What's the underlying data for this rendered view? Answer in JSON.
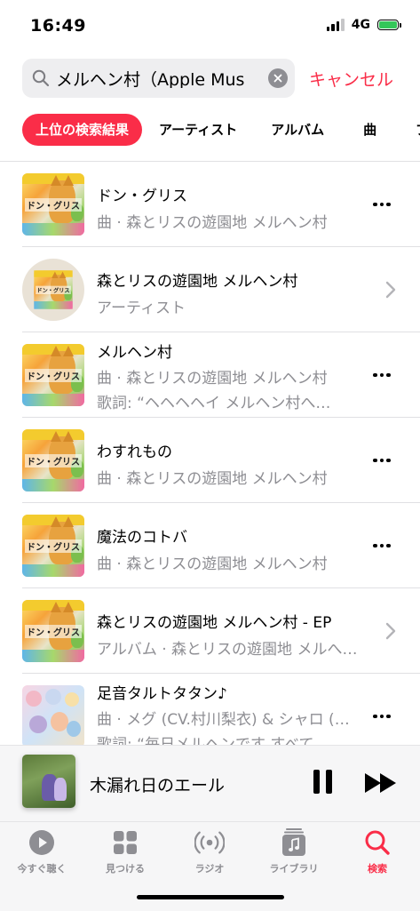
{
  "status": {
    "time": "16:49",
    "network": "4G"
  },
  "search": {
    "value": "メルヘン村（Apple Mus",
    "cancel_label": "キャンセル"
  },
  "tabs": [
    {
      "label": "上位の検索結果",
      "active": true
    },
    {
      "label": "アーティスト"
    },
    {
      "label": "アルバム"
    },
    {
      "label": "曲"
    },
    {
      "label": "プ"
    }
  ],
  "results": [
    {
      "title": "ドン・グリス",
      "subtitle": "曲 · 森とリスの遊園地 メルヘン村",
      "art_text": "ドン・グリス",
      "action": "more-icon"
    },
    {
      "title": "森とリスの遊園地 メルヘン村",
      "subtitle": "アーティスト",
      "art_text": "ドン・グリス",
      "action": "chevron-right-icon"
    },
    {
      "title": "メルヘン村",
      "subtitle": "曲 · 森とリスの遊園地 メルヘン村",
      "lyrics": "歌詞: “ヘヘヘヘイ メルヘン村へ…",
      "art_text": "ドン・グリス",
      "action": "more-icon"
    },
    {
      "title": "わすれもの",
      "subtitle": "曲 · 森とリスの遊園地 メルヘン村",
      "art_text": "ドン・グリス",
      "action": "more-icon"
    },
    {
      "title": "魔法のコトバ",
      "subtitle": "曲 · 森とリスの遊園地 メルヘン村",
      "art_text": "ドン・グリス",
      "action": "more-icon"
    },
    {
      "title": "森とリスの遊園地 メルヘン村 - EP",
      "subtitle": "アルバム · 森とリスの遊園地 メルへ…",
      "art_text": "ドン・グリス",
      "action": "chevron-right-icon"
    },
    {
      "title": "足音タルトタタン♪",
      "subtitle": "曲 · メグ (CV.村川梨衣) & シャロ (…",
      "lyrics": "歌詞: “毎日メルヘンです すべて…",
      "action": "more-icon"
    }
  ],
  "now_playing": {
    "title": "木漏れ日のエール"
  },
  "tabbar": [
    {
      "label": "今すぐ聴く",
      "icon": "play-circle-icon"
    },
    {
      "label": "見つける",
      "icon": "grid-icon"
    },
    {
      "label": "ラジオ",
      "icon": "radio-icon"
    },
    {
      "label": "ライブラリ",
      "icon": "library-icon"
    },
    {
      "label": "検索",
      "icon": "search-icon",
      "active": true
    }
  ],
  "colors": {
    "accent": "#fa2d48",
    "secondary_text": "#8e8e93"
  }
}
